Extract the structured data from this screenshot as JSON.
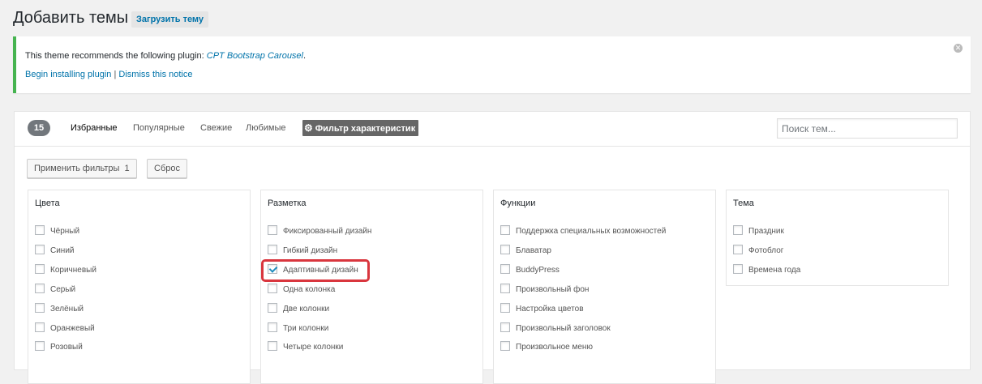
{
  "header": {
    "title": "Добавить темы",
    "upload_label": "Загрузить тему"
  },
  "notice": {
    "message_prefix": "This theme recommends the following plugin: ",
    "plugin_name": "CPT Bootstrap Carousel",
    "message_suffix": ".",
    "begin_link": "Begin installing plugin",
    "separator": "|",
    "dismiss_link": "Dismiss this notice",
    "close_icon": "close-icon"
  },
  "filterbar": {
    "count": "15",
    "tabs": [
      {
        "label": "Избранные",
        "active": true
      },
      {
        "label": "Популярные",
        "active": false
      },
      {
        "label": "Свежие",
        "active": false
      },
      {
        "label": "Любимые",
        "active": false
      }
    ],
    "feature_filter_label": "Фильтр характеристик",
    "search_placeholder": "Поиск тем..."
  },
  "actions": {
    "apply_label": "Применить фильтры",
    "apply_count": "1",
    "reset_label": "Сброс"
  },
  "groups": [
    {
      "title": "Цвета",
      "options": [
        {
          "label": "Чёрный",
          "checked": false
        },
        {
          "label": "Синий",
          "checked": false
        },
        {
          "label": "Коричневый",
          "checked": false
        },
        {
          "label": "Серый",
          "checked": false
        },
        {
          "label": "Зелёный",
          "checked": false
        },
        {
          "label": "Оранжевый",
          "checked": false
        },
        {
          "label": "Розовый",
          "checked": false
        }
      ]
    },
    {
      "title": "Разметка",
      "options": [
        {
          "label": "Фиксированный дизайн",
          "checked": false
        },
        {
          "label": "Гибкий дизайн",
          "checked": false
        },
        {
          "label": "Адаптивный дизайн",
          "checked": true
        },
        {
          "label": "Одна колонка",
          "checked": false
        },
        {
          "label": "Две колонки",
          "checked": false
        },
        {
          "label": "Три колонки",
          "checked": false
        },
        {
          "label": "Четыре колонки",
          "checked": false
        }
      ]
    },
    {
      "title": "Функции",
      "options": [
        {
          "label": "Поддержка специальных возможностей",
          "checked": false
        },
        {
          "label": "Блаватар",
          "checked": false
        },
        {
          "label": "BuddyPress",
          "checked": false
        },
        {
          "label": "Произвольный фон",
          "checked": false
        },
        {
          "label": "Настройка цветов",
          "checked": false
        },
        {
          "label": "Произвольный заголовок",
          "checked": false
        },
        {
          "label": "Произвольное меню",
          "checked": false
        }
      ]
    },
    {
      "title": "Тема",
      "options": [
        {
          "label": "Праздник",
          "checked": false
        },
        {
          "label": "Фотоблог",
          "checked": false
        },
        {
          "label": "Времена года",
          "checked": false
        }
      ]
    }
  ],
  "colors": {
    "accent": "#0073aa",
    "notice_border": "#46b450",
    "highlight": "#d9363e"
  }
}
